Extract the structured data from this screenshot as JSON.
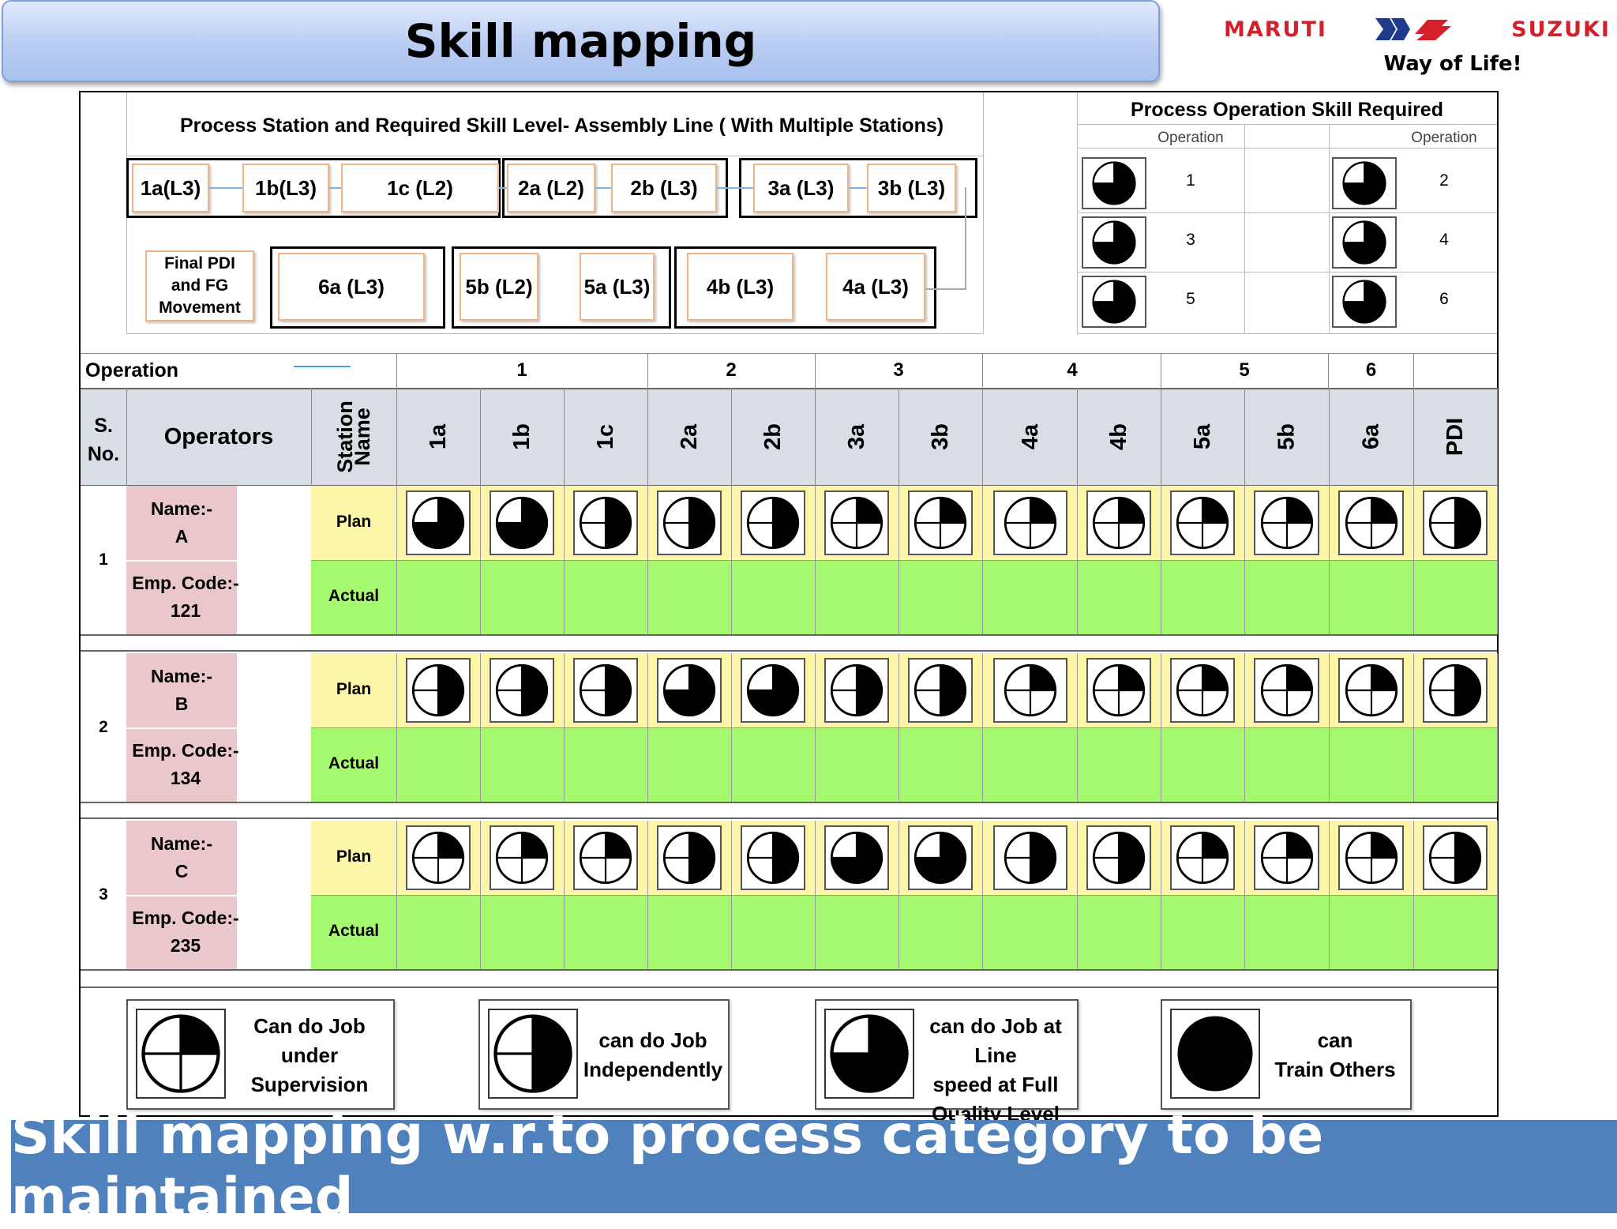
{
  "header": {
    "title": "Skill mapping"
  },
  "logo": {
    "left_text": "MARUTI",
    "right_text": "SUZUKI",
    "tagline": "Way of Life!"
  },
  "process": {
    "title": "Process Station and Required Skill Level- Assembly Line ( With Multiple Stations)",
    "row1": [
      "1a(L3)",
      "1b(L3)",
      "1c (L2)",
      "2a (L2)",
      "2b (L3)",
      "3a (L3)",
      "3b (L3)"
    ],
    "final": [
      "Final PDI",
      "and FG",
      "Movement"
    ],
    "row2": [
      "6a (L3)",
      "5b (L2)",
      "5a (L3)",
      "4b (L3)",
      "4a (L3)"
    ]
  },
  "skill_required": {
    "title": "Process Operation Skill Required",
    "col_header": "Operation",
    "ops": [
      {
        "op": "1",
        "level": 3
      },
      {
        "op": "2",
        "level": 3
      },
      {
        "op": "3",
        "level": 3
      },
      {
        "op": "4",
        "level": 3
      },
      {
        "op": "5",
        "level": 3
      },
      {
        "op": "6",
        "level": 3
      }
    ]
  },
  "table": {
    "operation_label": "Operation",
    "operation_groups": [
      "1",
      "2",
      "3",
      "4",
      "5",
      "6"
    ],
    "header": {
      "sno": [
        "S.",
        "No."
      ],
      "operators": "Operators",
      "station": [
        "Station",
        "Name"
      ]
    },
    "stations": [
      "1a",
      "1b",
      "1c",
      "2a",
      "2b",
      "3a",
      "3b",
      "4a",
      "4b",
      "5a",
      "5b",
      "6a",
      "PDI"
    ],
    "plan_label": "Plan",
    "actual_label": "Actual",
    "operators": [
      {
        "sno": "1",
        "name_label": "Name:-",
        "name": "A",
        "code_label": "Emp. Code:-",
        "code": "121",
        "plan": [
          3,
          3,
          2,
          2,
          2,
          1,
          1,
          1,
          1,
          1,
          1,
          1,
          2
        ]
      },
      {
        "sno": "2",
        "name_label": "Name:-",
        "name": "B",
        "code_label": "Emp. Code:-",
        "code": "134",
        "plan": [
          2,
          2,
          2,
          3,
          3,
          2,
          2,
          1,
          1,
          1,
          1,
          1,
          2
        ]
      },
      {
        "sno": "3",
        "name_label": "Name:-",
        "name": "C",
        "code_label": "Emp. Code:-",
        "code": "235",
        "plan": [
          1,
          1,
          1,
          2,
          2,
          3,
          3,
          2,
          2,
          1,
          1,
          1,
          2
        ]
      }
    ]
  },
  "legend": [
    {
      "level": 1,
      "lines": [
        "Can do Job",
        "under",
        "Supervision"
      ]
    },
    {
      "level": 2,
      "lines": [
        "can do Job",
        "Independently"
      ]
    },
    {
      "level": 3,
      "lines": [
        "can do Job at Line",
        "speed at Full",
        "Quality Level"
      ]
    },
    {
      "level": 4,
      "lines": [
        "can",
        "Train Others"
      ]
    }
  ],
  "footer": {
    "text": "Skill mapping w.r.to process category to be maintained"
  },
  "colors": {
    "plan_row": "#fdf6a8",
    "actual_row": "#a4f96e",
    "header_row": "#d9dde6",
    "name_cell": "#e9c7cb",
    "footer": "#4f81bd",
    "brand_red": "#d4202a"
  }
}
